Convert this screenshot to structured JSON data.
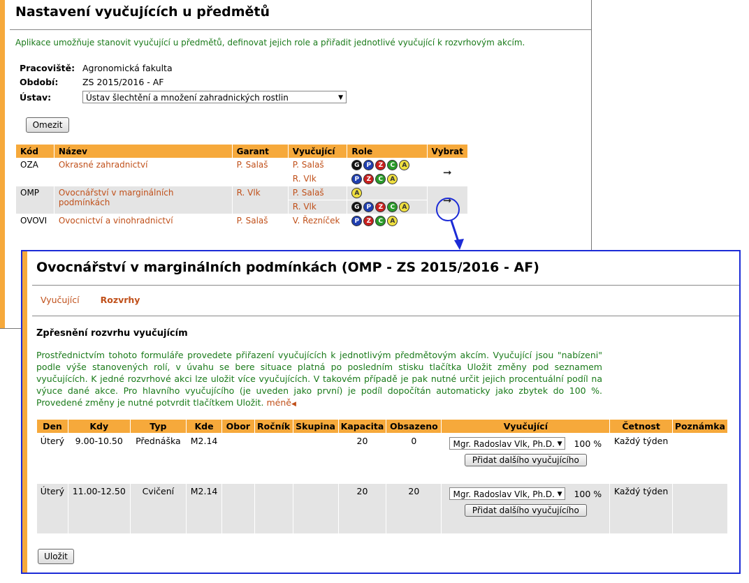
{
  "back": {
    "title": "Nastavení vyučujících u předmětů",
    "intro": "Aplikace umožňuje stanovit vyučující u předmětů, definovat jejich role a přiřadit jednotlivé vyučující k rozvrhovým akcím.",
    "fields": {
      "pracoviste_label": "Pracoviště:",
      "pracoviste_value": "Agronomická fakulta",
      "obdobi_label": "Období:",
      "obdobi_value": "ZS 2015/2016 - AF",
      "ustav_label": "Ústav:",
      "ustav_value": "Ústav šlechtění a množení zahradnických rostlin"
    },
    "filter_button": "Omezit",
    "headers": [
      "Kód",
      "Název",
      "Garant",
      "Vyučující",
      "Role",
      "Vybrat"
    ],
    "rows": [
      {
        "code": "OZA",
        "name": "Okrasné zahradnictví",
        "garant": "P. Salaš",
        "teachers": [
          {
            "name": "P. Salaš",
            "roles": [
              "G",
              "P",
              "Z",
              "C",
              "A"
            ]
          },
          {
            "name": "R. Vlk",
            "roles": [
              "P",
              "Z",
              "C",
              "A"
            ]
          }
        ]
      },
      {
        "code": "OMP",
        "name": "Ovocnářství v marginálních podmínkách",
        "garant": "R. Vlk",
        "teachers": [
          {
            "name": "P. Salaš",
            "roles": [
              "A"
            ]
          },
          {
            "name": "R. Vlk",
            "roles": [
              "G",
              "P",
              "Z",
              "C",
              "A"
            ]
          }
        ]
      },
      {
        "code": "OVOVI",
        "name": "Ovocnictví a vinohradnictví",
        "garant": "P. Salaš",
        "teachers": [
          {
            "name": "V. Řezníček",
            "roles": [
              "P",
              "Z",
              "C",
              "A"
            ]
          }
        ]
      }
    ],
    "select_icon": "arrow-right-icon"
  },
  "front": {
    "title": "Ovocnářství v marginálních podmínkách (OMP - ZS 2015/2016 - AF)",
    "tabs": [
      "Vyučující",
      "Rozvrhy"
    ],
    "section_title": "Zpřesnění rozvrhu vyučujícím",
    "paragraph": "Prostřednictvím tohoto formuláře provedete přiřazení vyučujících k jednotlivým předmětovým akcím. Vyučující jsou \"nabízeni\" podle výše stanovených rolí, v úvahu se bere situace platná po posledním stisku tlačítka Uložit změny pod seznamem vyučujících. K jedné rozvrhové akci lze uložit více vyučujících. V takovém případě je pak nutné určit jejich procentuální podíl na výuce dané akce. Pro hlavního vyučujícího (je uveden jako první) je podíl dopočítán automaticky jako zbytek do 100 %. Provedené změny je nutné potvrdit tlačítkem Uložit.",
    "less_link": "méně",
    "headers": [
      "Den",
      "Kdy",
      "Typ",
      "Kde",
      "Obor",
      "Ročník",
      "Skupina",
      "Kapacita",
      "Obsazeno",
      "Vyučující",
      "Četnost",
      "Poznámka"
    ],
    "rows": [
      {
        "den": "Úterý",
        "kdy": "9.00-10.50",
        "typ": "Přednáška",
        "kde": "M2.14",
        "obor": "",
        "rocnik": "",
        "skupina": "",
        "kapacita": "20",
        "obsazeno": "0",
        "teacher": "Mgr. Radoslav Vlk, Ph.D.",
        "percent": "100 %",
        "cetnost": "Každý týden",
        "poznamka": ""
      },
      {
        "den": "Úterý",
        "kdy": "11.00-12.50",
        "typ": "Cvičení",
        "kde": "M2.14",
        "obor": "",
        "rocnik": "",
        "skupina": "",
        "kapacita": "20",
        "obsazeno": "20",
        "teacher": "Mgr. Radoslav Vlk, Ph.D.",
        "percent": "100 %",
        "cetnost": "Každý týden",
        "poznamka": ""
      }
    ],
    "add_teacher_button": "Přidat dalšího vyučujícího",
    "save_button": "Uložit"
  },
  "colors": {
    "accent": "#f6a93b",
    "link": "#c0501a",
    "intro_text": "#1a7a1a",
    "highlight": "#1c2bd6"
  }
}
